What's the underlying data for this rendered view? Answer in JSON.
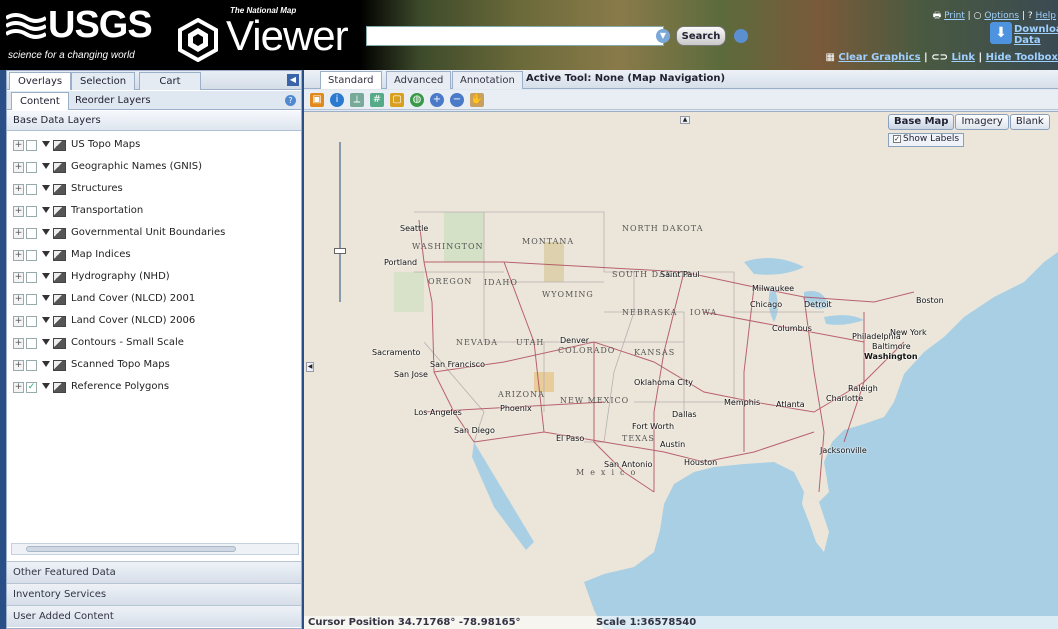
{
  "header": {
    "usgs_logo": "USGS",
    "usgs_tagline": "science for a changing world",
    "viewer_subtitle": "The National Map",
    "viewer_title": "Viewer",
    "search_placeholder": "",
    "search_button": "Search",
    "links": {
      "print": "Print",
      "options": "Options",
      "help": "Help"
    },
    "download": {
      "line1": "Download",
      "line2": "Data"
    },
    "bottom_links": {
      "clear_graphics": "Clear Graphics",
      "link": "Link",
      "hide_toolbox": "Hide Toolbox"
    }
  },
  "left_panel": {
    "tabs": [
      "Overlays",
      "Selection",
      "Cart"
    ],
    "subtabs": [
      "Content",
      "Reorder Layers"
    ],
    "section_title": "Base Data Layers",
    "layers": [
      {
        "label": "US Topo Maps",
        "checked": false
      },
      {
        "label": "Geographic Names (GNIS)",
        "checked": false
      },
      {
        "label": "Structures",
        "checked": false
      },
      {
        "label": "Transportation",
        "checked": false
      },
      {
        "label": "Governmental Unit Boundaries",
        "checked": false
      },
      {
        "label": "Map Indices",
        "checked": false
      },
      {
        "label": "Hydrography (NHD)",
        "checked": false
      },
      {
        "label": "Land Cover (NLCD) 2001",
        "checked": false
      },
      {
        "label": "Land Cover (NLCD) 2006",
        "checked": false
      },
      {
        "label": "Contours - Small Scale",
        "checked": false
      },
      {
        "label": "Scanned Topo Maps",
        "checked": false
      },
      {
        "label": "Reference Polygons",
        "checked": true
      }
    ],
    "accordion": [
      "Other Featured Data",
      "Inventory Services",
      "User Added Content"
    ]
  },
  "map_panel": {
    "tabs": [
      "Standard",
      "Advanced",
      "Annotation"
    ],
    "active_tool": "Active Tool: None (Map Navigation)",
    "basemap_buttons": [
      "Base Map",
      "Imagery",
      "Blank"
    ],
    "show_labels": "Show Labels",
    "cursor_position": "Cursor Position 34.71768° -78.98165°",
    "scale": "Scale 1:36578540",
    "states": [
      "NORTH DAKOTA",
      "MONTANA",
      "WASHINGTON",
      "OREGON",
      "IDAHO",
      "WYOMING",
      "SOUTH DAKOTA",
      "NEBRASKA",
      "IOWA",
      "NEVADA",
      "UTAH",
      "COLORADO",
      "KANSAS",
      "ARIZONA",
      "NEW MEXICO",
      "TEXAS",
      "Mexico"
    ],
    "cities": [
      "Seattle",
      "Portland",
      "Sacramento",
      "San Francisco",
      "San Jose",
      "Los Angeles",
      "San Diego",
      "Phoenix",
      "Denver",
      "El Paso",
      "Fort Worth",
      "Dallas",
      "Austin",
      "San Antonio",
      "Houston",
      "Oklahoma City",
      "Saint Paul",
      "Milwaukee",
      "Chicago",
      "Detroit",
      "Columbus",
      "Memphis",
      "Atlanta",
      "Charlotte",
      "Raleigh",
      "Washington",
      "Baltimore",
      "Philadelphia",
      "New York",
      "Boston",
      "Jacksonville"
    ]
  },
  "colors": {
    "header_bg": "#000000",
    "link": "#9fd0ff",
    "panel_border": "#9bb0c8",
    "water": "#a9cfe4",
    "land": "#ece6da",
    "road": "#b04a5a"
  }
}
